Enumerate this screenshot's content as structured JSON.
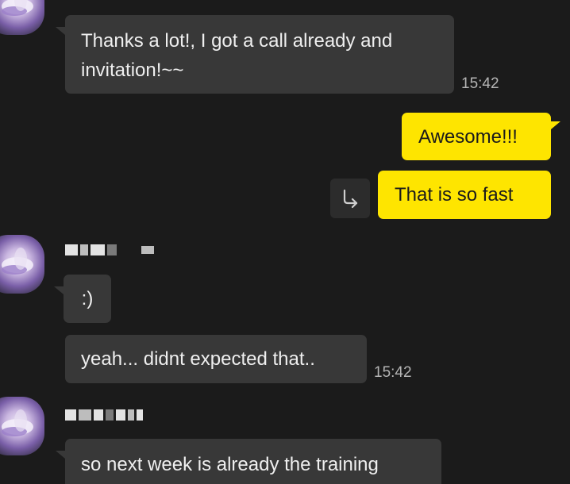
{
  "conversation": {
    "messages": [
      {
        "direction": "in",
        "text": "Thanks a lot!, I got a call already and\ninvitation!~~",
        "time": "15:42"
      },
      {
        "direction": "out",
        "text": "Awesome!!!"
      },
      {
        "direction": "out",
        "text": "That is so fast"
      },
      {
        "direction": "in",
        "text": ":)"
      },
      {
        "direction": "in",
        "text": "yeah... didnt expected that..",
        "time": "15:42"
      },
      {
        "direction": "in",
        "text": "so next week is already the training"
      }
    ]
  },
  "icons": {
    "reply": "reply-arrow-icon",
    "avatar": "flower-avatar-icon"
  },
  "colors": {
    "background": "#1b1b1b",
    "incoming_bubble": "#383838",
    "outgoing_bubble": "#fee500",
    "timestamp": "#b5b5b5"
  }
}
